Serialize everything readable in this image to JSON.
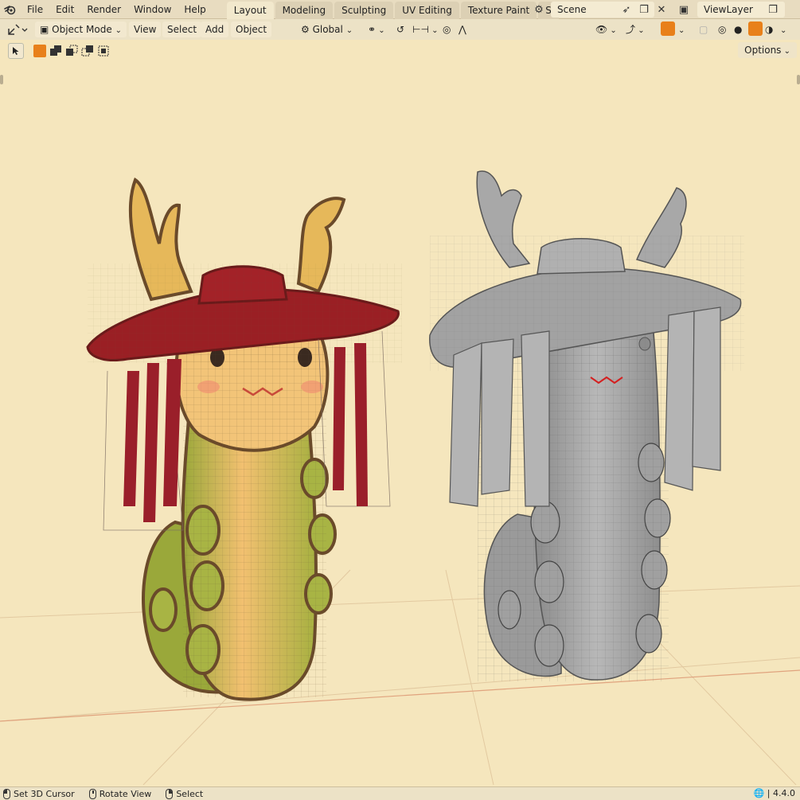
{
  "topbar": {
    "menu": [
      "File",
      "Edit",
      "Render",
      "Window",
      "Help"
    ],
    "tabs": [
      {
        "label": "Layout",
        "active": true
      },
      {
        "label": "Modeling",
        "active": false
      },
      {
        "label": "Sculpting",
        "active": false
      },
      {
        "label": "UV Editing",
        "active": false
      },
      {
        "label": "Texture Paint",
        "active": false
      },
      {
        "label": "S",
        "active": false
      }
    ],
    "scene": "Scene",
    "view_layer": "ViewLayer"
  },
  "toolbar": {
    "mode": "Object Mode",
    "menus": [
      "View",
      "Select",
      "Add",
      "Object"
    ],
    "orientation": "Global"
  },
  "tool_settings": {
    "options_label": "Options"
  },
  "viewport": {
    "accent_orange": "#e8801a",
    "grid_line": "#e6c9a3",
    "background": "#f5e6bd"
  },
  "statusbar": {
    "items": [
      "Set 3D Cursor",
      "Rotate View",
      "Select"
    ],
    "version": "4.4.0"
  }
}
